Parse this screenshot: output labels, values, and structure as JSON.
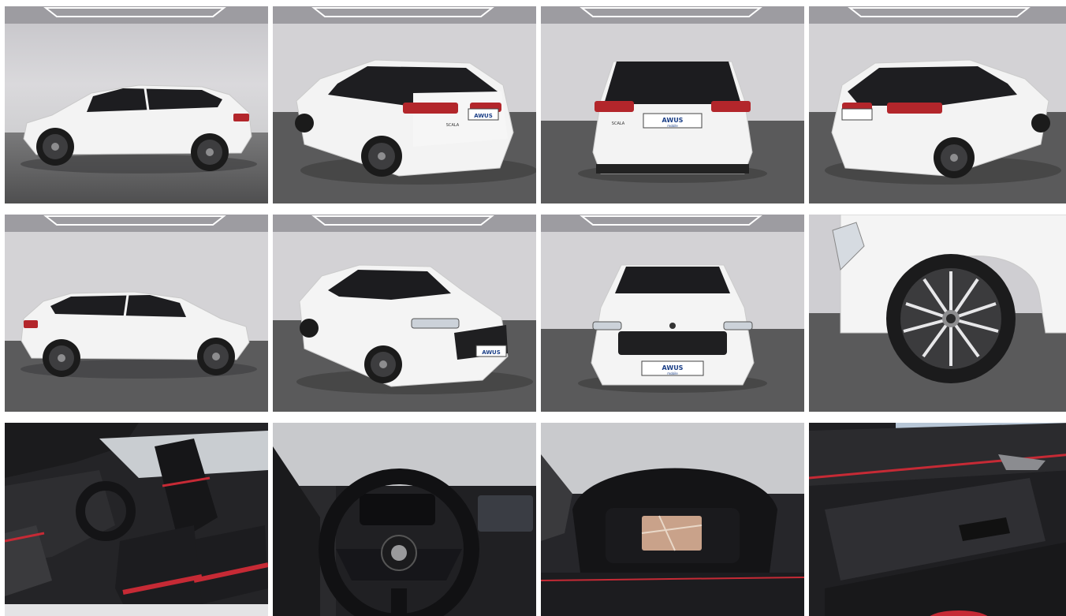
{
  "gallery": {
    "photos": [
      {
        "id": "side-left",
        "alt": ""
      },
      {
        "id": "rear-three-quarter-left",
        "alt": ""
      },
      {
        "id": "rear",
        "alt": ""
      },
      {
        "id": "rear-three-quarter-right",
        "alt": ""
      },
      {
        "id": "side-right",
        "alt": ""
      },
      {
        "id": "front-three-quarter-left",
        "alt": ""
      },
      {
        "id": "front",
        "alt": ""
      },
      {
        "id": "wheel-closeup",
        "alt": ""
      },
      {
        "id": "interior-front-seats",
        "alt": ""
      },
      {
        "id": "steering-wheel",
        "alt": ""
      },
      {
        "id": "instrument-cluster",
        "alt": ""
      },
      {
        "id": "door-panel",
        "alt": ""
      }
    ],
    "plate_text": "AWUS",
    "plate_subtext": "mobile",
    "badge_text": "SCALA",
    "colors": {
      "studio_wall": "#d4d3d6",
      "studio_floor": "#5a5a5a",
      "car_body": "#f4f4f4",
      "car_roof": "#1b1b1d",
      "tail_light": "#b3262b",
      "interior_dark": "#1f1f22",
      "interior_red": "#c62a35"
    }
  }
}
